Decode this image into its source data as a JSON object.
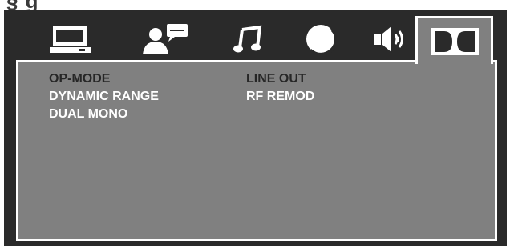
{
  "menu": {
    "tabs": [
      {
        "id": "general",
        "icon": "monitor-icon",
        "selected": false
      },
      {
        "id": "language",
        "icon": "speaker-person-icon",
        "selected": false
      },
      {
        "id": "audio",
        "icon": "music-note-icon",
        "selected": false
      },
      {
        "id": "video",
        "icon": "color-circle-icon",
        "selected": false
      },
      {
        "id": "speaker",
        "icon": "speaker-volume-icon",
        "selected": false
      },
      {
        "id": "dolby",
        "icon": "dolby-digital-icon",
        "selected": true
      }
    ],
    "left_items": [
      "OP-MODE",
      "DYNAMIC RANGE",
      "DUAL MONO"
    ],
    "right_items": [
      "LINE OUT",
      "RF REMOD"
    ]
  },
  "colors": {
    "background": "#2a2a2a",
    "panel": "#808080",
    "border": "#ffffff",
    "highlight_text": "#262626",
    "normal_text": "#ffffff"
  }
}
